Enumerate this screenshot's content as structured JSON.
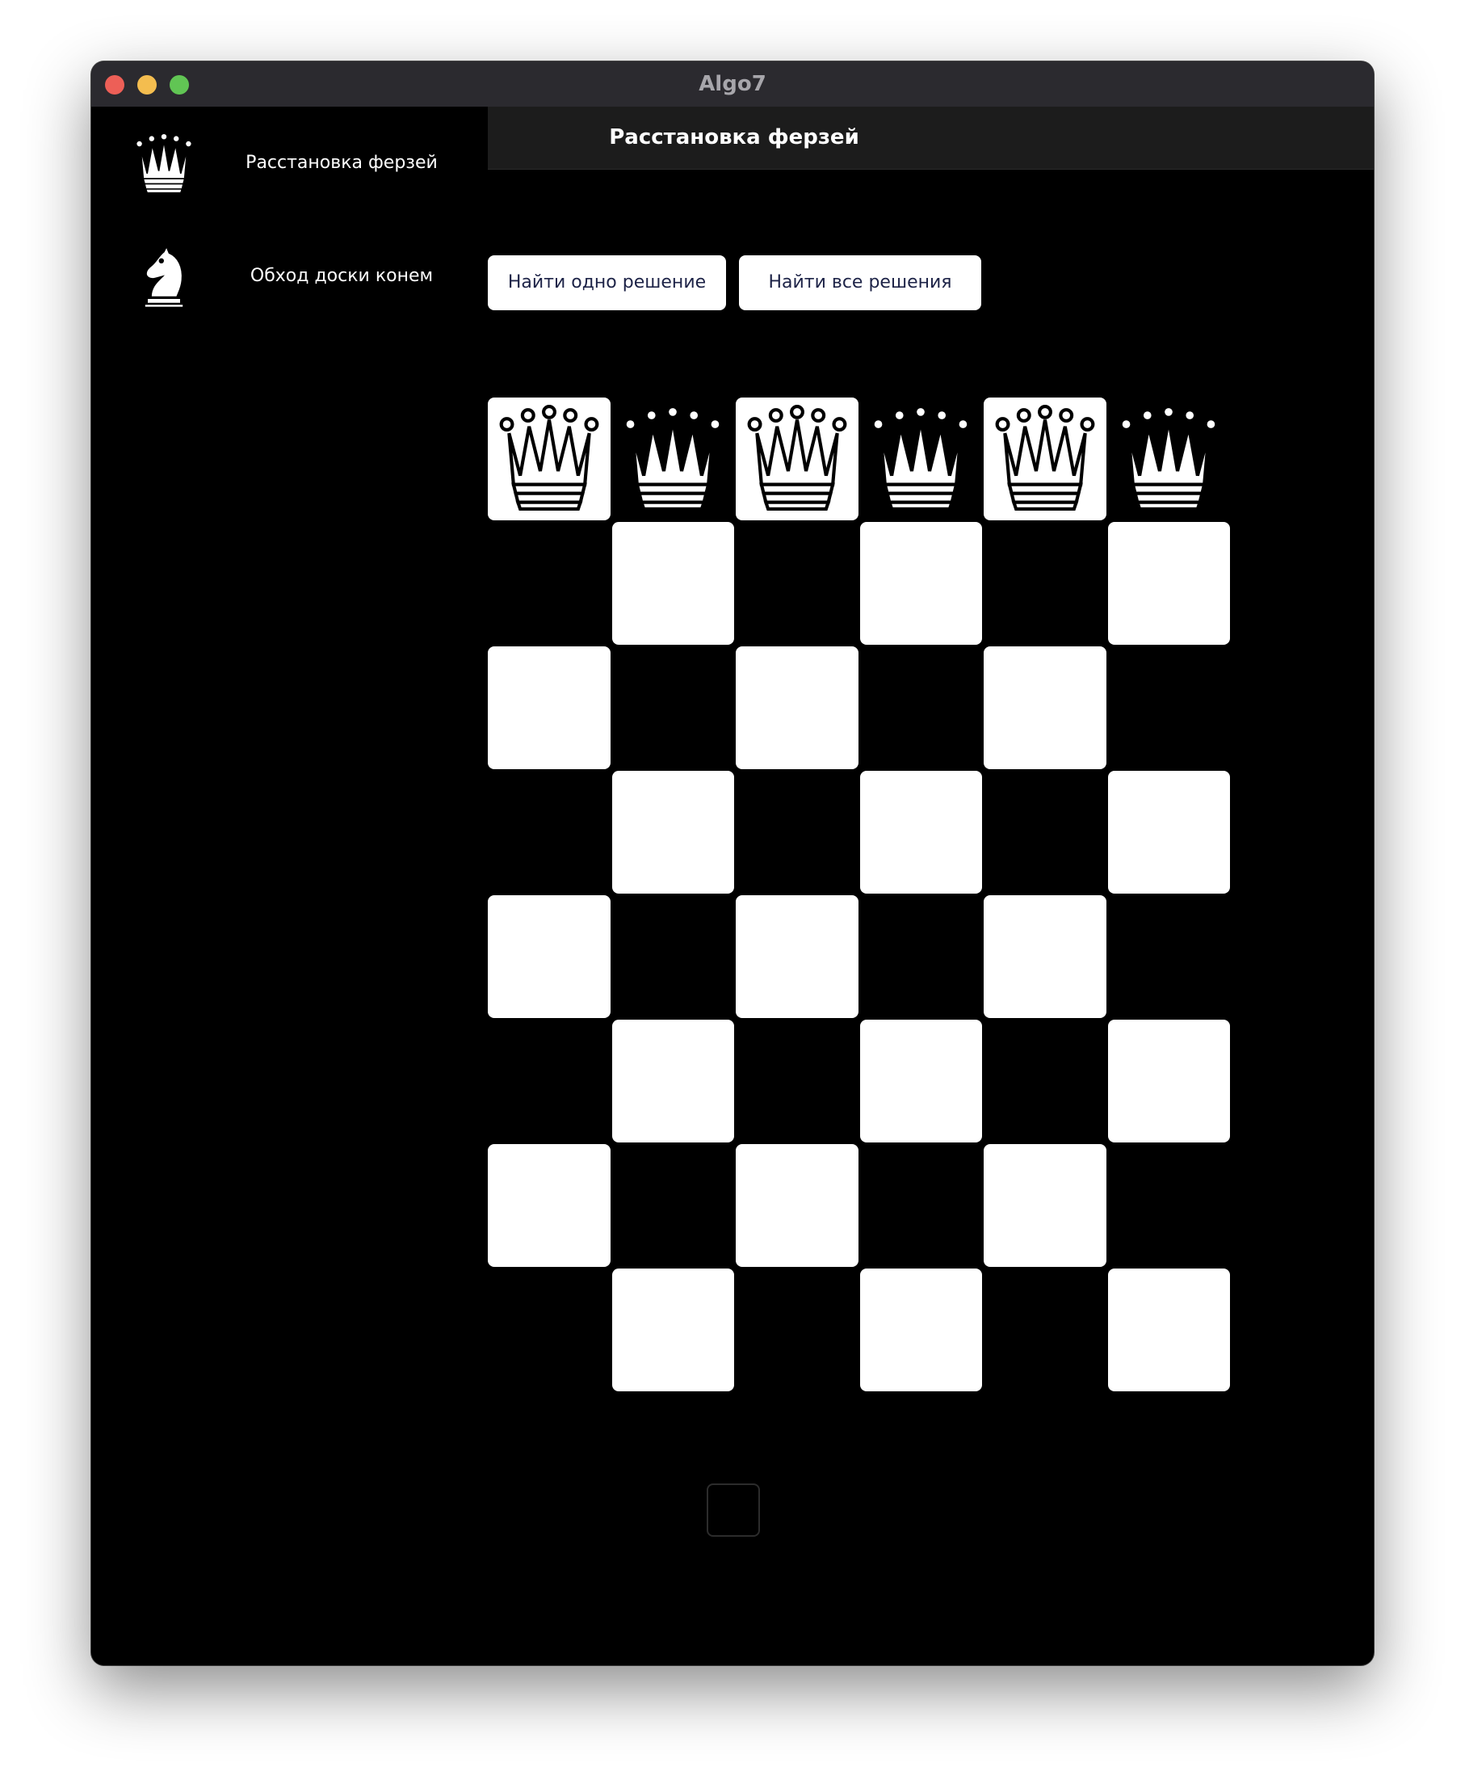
{
  "window": {
    "title": "Algo7"
  },
  "sidebar": {
    "items": [
      {
        "label": "Расстановка ферзей",
        "icon": "queen-icon"
      },
      {
        "label": "Обход доски конем",
        "icon": "knight-icon"
      }
    ]
  },
  "header": {
    "title": "Расстановка ферзей"
  },
  "actions": {
    "find_one_label": "Найти одно решение",
    "find_all_label": "Найти все решения"
  },
  "board": {
    "columns": 6,
    "rows": 8,
    "queens_row": 0,
    "queen_columns": [
      0,
      1,
      2,
      3,
      4,
      5
    ],
    "light_color": "#ffffff",
    "dark_color": "#000000"
  }
}
